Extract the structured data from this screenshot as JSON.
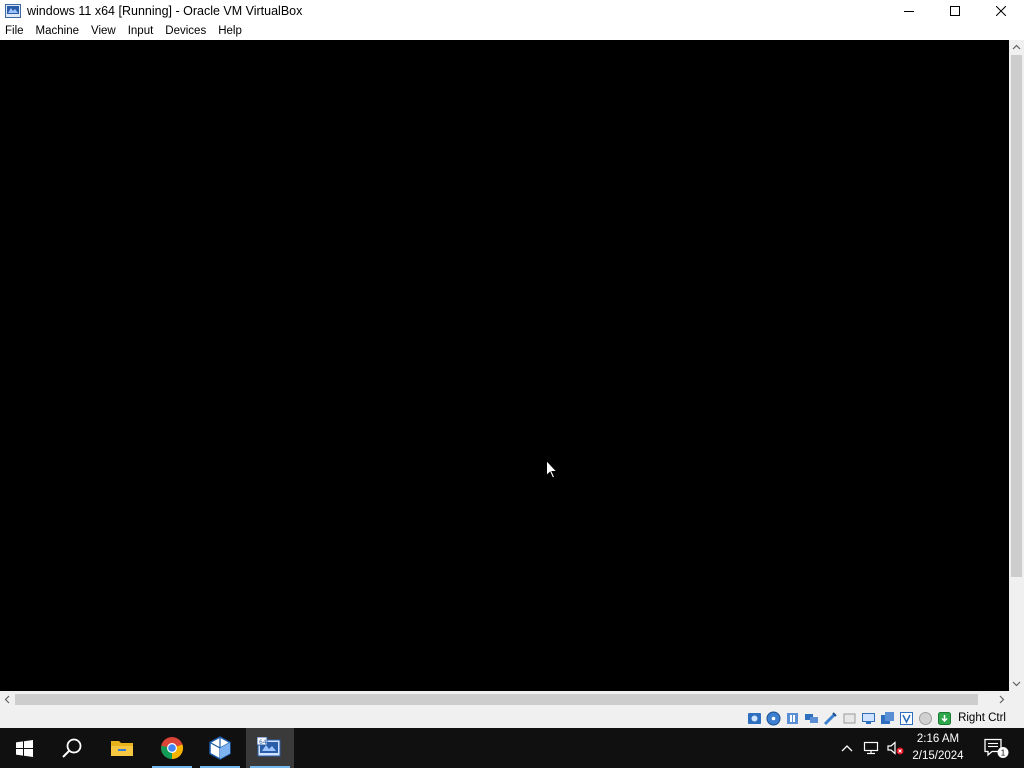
{
  "window": {
    "title": "windows 11 x64 [Running] - Oracle VM VirtualBox",
    "icon": "virtualbox-app-icon",
    "controls": [
      "minimize-icon",
      "maximize-icon",
      "close-icon"
    ]
  },
  "menubar": {
    "items": [
      {
        "label": "File"
      },
      {
        "label": "Machine"
      },
      {
        "label": "View"
      },
      {
        "label": "Input"
      },
      {
        "label": "Devices"
      },
      {
        "label": "Help"
      }
    ]
  },
  "vm_display": {
    "background": "#000000",
    "state": "blank screen with mouse cursor"
  },
  "statusbar": {
    "icons": [
      "hard-disk-icon",
      "optical-drive-icon",
      "audio-icon",
      "network-icon",
      "usb-icon",
      "shared-folders-icon",
      "display-icon",
      "recording-icon",
      "video-capture-icon",
      "mouse-integration-icon",
      "keyboard-capture-icon"
    ],
    "host_key": "Right Ctrl"
  },
  "taskbar": {
    "apps": [
      {
        "name": "start-button",
        "icon": "windows-logo-icon"
      },
      {
        "name": "search-button",
        "icon": "search-icon"
      },
      {
        "name": "file-explorer",
        "icon": "folder-icon"
      },
      {
        "name": "google-chrome",
        "icon": "chrome-icon"
      },
      {
        "name": "virtualbox-manager",
        "icon": "virtualbox-icon"
      },
      {
        "name": "virtualbox-vm-window",
        "icon": "vm-window-icon"
      }
    ],
    "tray": {
      "icons": [
        "show-hidden-icons-chevron",
        "network-icon",
        "volume-muted-icon"
      ],
      "time": "2:16 AM",
      "date": "2/15/2024",
      "notification_count": "1"
    }
  },
  "colors": {
    "taskbar": "#101010",
    "accent": "#76b9ed",
    "vm_screen": "#000000",
    "chrome": "#f0f0f0"
  }
}
